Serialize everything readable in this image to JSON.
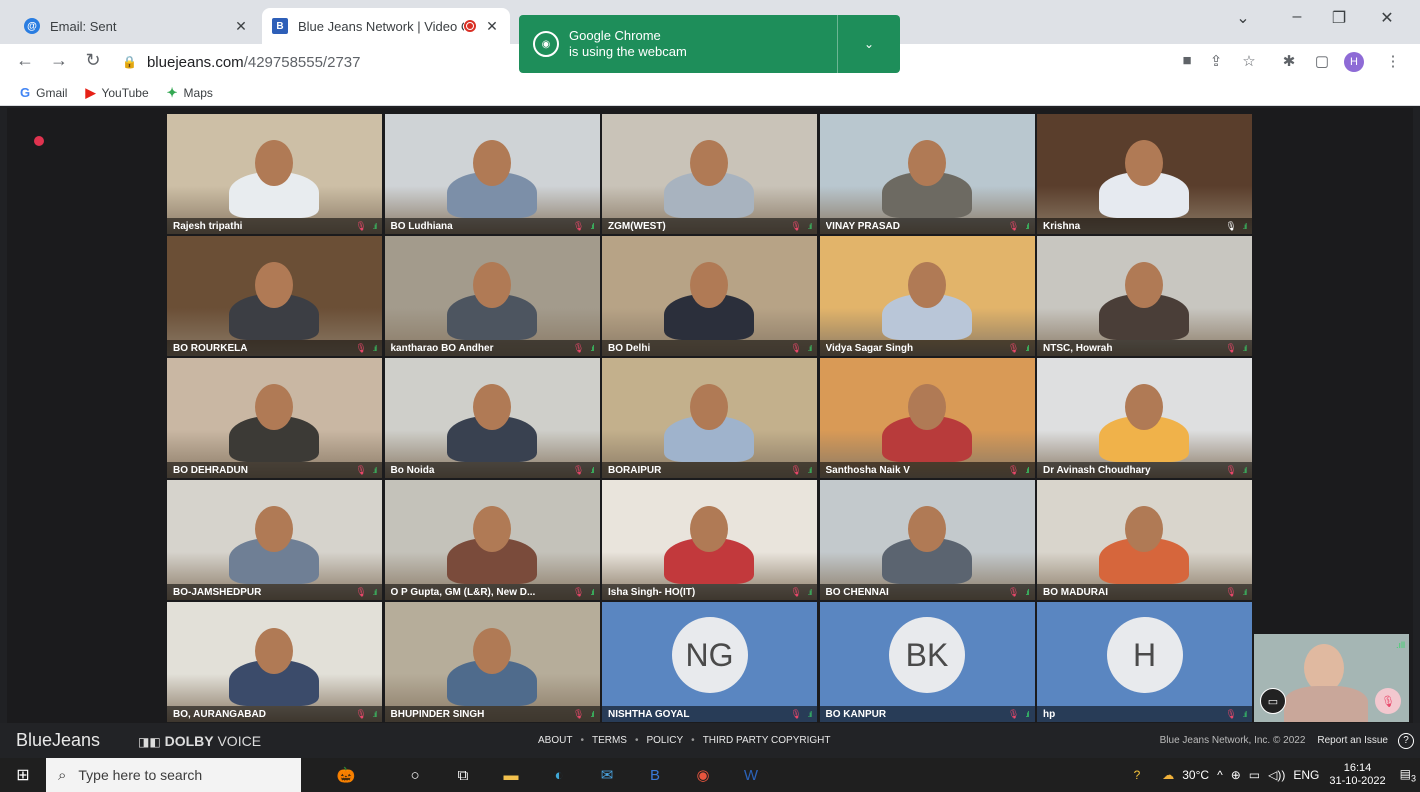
{
  "browser": {
    "tabs": [
      {
        "title": "Email: Sent",
        "active": false
      },
      {
        "title": "Blue Jeans Network | Video C",
        "active": true
      }
    ],
    "url_host": "bluejeans.com",
    "url_path": "/429758555/2737",
    "bookmarks": [
      {
        "label": "Gmail",
        "icon": "google-icon"
      },
      {
        "label": "YouTube",
        "icon": "youtube-icon"
      },
      {
        "label": "Maps",
        "icon": "maps-icon"
      }
    ],
    "profile_initial": "H",
    "webcam_popup": {
      "line1": "Google Chrome",
      "line2": "is using the webcam"
    }
  },
  "meeting": {
    "participants": [
      {
        "name": "Rajesh tripathi",
        "type": "video",
        "bg": "#cdbfa6",
        "shirt": "#e8ecef",
        "speaking": false
      },
      {
        "name": "BO Ludhiana",
        "type": "video",
        "bg": "#cfd3d6",
        "shirt": "#7c8fa8",
        "speaking": false
      },
      {
        "name": "ZGM(WEST)",
        "type": "video",
        "bg": "#c9c3b8",
        "shirt": "#a8b3bf",
        "speaking": false
      },
      {
        "name": "VINAY PRASAD",
        "type": "video",
        "bg": "#b9c7cf",
        "shirt": "#6d6a62",
        "speaking": false
      },
      {
        "name": "Krishna",
        "type": "video",
        "bg": "#5a3e2c",
        "shirt": "#e6eaf0",
        "speaking": true
      },
      {
        "name": "BO ROURKELA",
        "type": "video",
        "bg": "#6b4f36",
        "shirt": "#3c3e44",
        "speaking": false
      },
      {
        "name": "kantharao BO Andher",
        "type": "video",
        "bg": "#a39b8c",
        "shirt": "#4d5560",
        "speaking": false
      },
      {
        "name": "BO Delhi",
        "type": "video",
        "bg": "#b7a386",
        "shirt": "#2b2f3b",
        "speaking": false
      },
      {
        "name": "Vidya Sagar Singh",
        "type": "video",
        "bg": "#e2b46a",
        "shirt": "#b9c6d8",
        "speaking": false
      },
      {
        "name": "NTSC, Howrah",
        "type": "video",
        "bg": "#c8c6c0",
        "shirt": "#4a3e38",
        "speaking": false
      },
      {
        "name": "BO DEHRADUN",
        "type": "video",
        "bg": "#c9b7a3",
        "shirt": "#3c3a36",
        "speaking": false
      },
      {
        "name": "Bo Noida",
        "type": "video",
        "bg": "#cfcfca",
        "shirt": "#394150",
        "speaking": false
      },
      {
        "name": "BORAIPUR",
        "type": "video",
        "bg": "#c3b08c",
        "shirt": "#9fb3cc",
        "speaking": false
      },
      {
        "name": "Santhosha Naik V",
        "type": "video",
        "bg": "#d99a56",
        "shirt": "#b83b3b",
        "speaking": false
      },
      {
        "name": "Dr Avinash Choudhary",
        "type": "video",
        "bg": "#dedfe0",
        "shirt": "#f0b24a",
        "speaking": false
      },
      {
        "name": "BO-JAMSHEDPUR",
        "type": "video",
        "bg": "#d6d3cc",
        "shirt": "#6f7f95",
        "speaking": false
      },
      {
        "name": "O P Gupta, GM (L&R), New D...",
        "type": "video",
        "bg": "#c4c2ba",
        "shirt": "#7a4b3b",
        "speaking": false
      },
      {
        "name": "Isha Singh- HO(IT)",
        "type": "video",
        "bg": "#e9e4dc",
        "shirt": "#c2393c",
        "speaking": false
      },
      {
        "name": "BO CHENNAI",
        "type": "video",
        "bg": "#c3c9cc",
        "shirt": "#5b6470",
        "speaking": false
      },
      {
        "name": "BO MADURAI",
        "type": "video",
        "bg": "#d9d5cc",
        "shirt": "#d6663c",
        "speaking": false
      },
      {
        "name": "BO, AURANGABAD",
        "type": "video",
        "bg": "#e2e0d8",
        "shirt": "#3b4b6a",
        "speaking": false
      },
      {
        "name": "BHUPINDER SINGH",
        "type": "video",
        "bg": "#b6ad9a",
        "shirt": "#4f6b8c",
        "speaking": false
      },
      {
        "name": "NISHTHA GOYAL",
        "type": "avatar",
        "initials": "NG",
        "speaking": false
      },
      {
        "name": "BO KANPUR",
        "type": "avatar",
        "initials": "BK",
        "speaking": false
      },
      {
        "name": "hp",
        "type": "avatar",
        "initials": "H",
        "speaking": false
      }
    ]
  },
  "footer": {
    "brand": "BlueJeans",
    "dolby_strong": "DOLBY",
    "dolby_light": "VOICE",
    "links": [
      "ABOUT",
      "TERMS",
      "POLICY",
      "THIRD PARTY COPYRIGHT"
    ],
    "copyright": "Blue Jeans Network, Inc. © 2022",
    "report": "Report an Issue"
  },
  "taskbar": {
    "search_placeholder": "Type here to search",
    "temperature": "30°C",
    "language": "ENG",
    "time": "16:14",
    "date": "31-10-2022",
    "notifications": "3"
  }
}
